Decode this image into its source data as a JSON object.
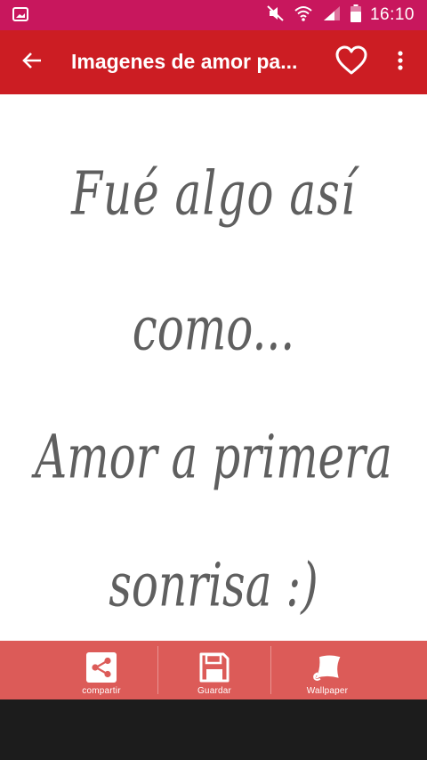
{
  "status_bar": {
    "time": "16:10",
    "icons": [
      "gallery-icon",
      "mute-icon",
      "wifi-icon",
      "signal-icon",
      "battery-icon"
    ]
  },
  "app_bar": {
    "title": "Imagenes de amor pa...",
    "back_icon": "arrow-left-icon",
    "favorite_icon": "heart-outline-icon",
    "more_icon": "more-vertical-icon"
  },
  "image": {
    "lines": [
      "Fué algo así",
      "como...",
      "Amor a primera",
      "sonrisa :)"
    ]
  },
  "actions": [
    {
      "label": "compartir",
      "icon": "share-icon"
    },
    {
      "label": "Guardar",
      "icon": "save-icon"
    },
    {
      "label": "Wallpaper",
      "icon": "wallpaper-icon"
    }
  ],
  "colors": {
    "status_bar": "#c8175d",
    "app_bar": "#cc1d23",
    "action_bar": "#dc5b58",
    "quote_text": "#5f5f5f"
  }
}
